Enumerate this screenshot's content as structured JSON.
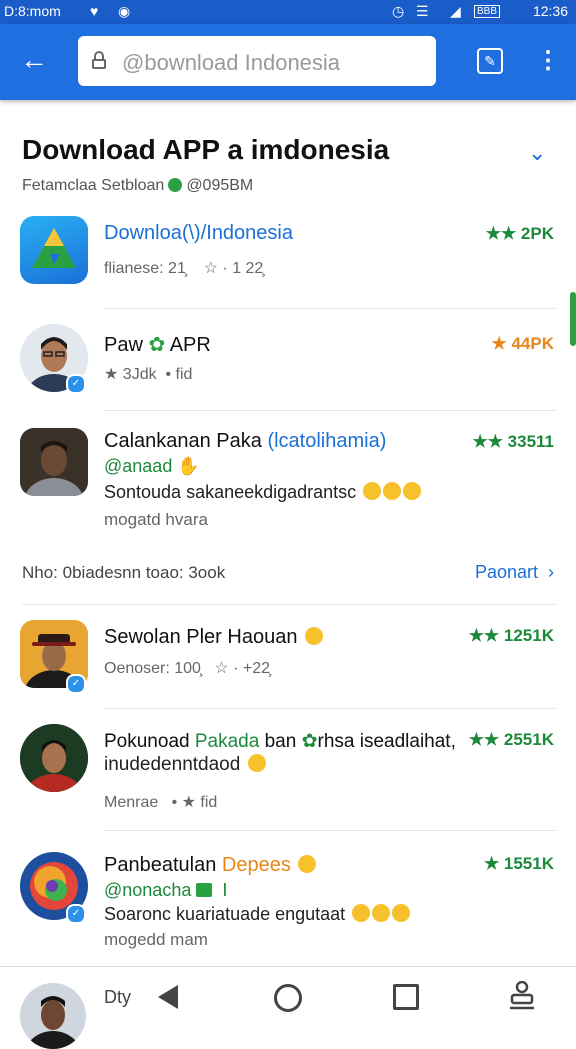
{
  "status_bar": {
    "left_time": "D:8:mom",
    "right_time": "12:36",
    "icons": [
      "heart-icon",
      "notification-icon",
      "alarm-icon",
      "wifi-icon",
      "signal-icon",
      "battery-icon"
    ],
    "battery_text": "BBB"
  },
  "app_bar": {
    "url_text": "@bownload   Indonesia"
  },
  "page": {
    "title": "Download APP a imdonesia",
    "subtitle_left": "Fetamclaa Setbloan",
    "subtitle_right": "@095BM"
  },
  "items_top": [
    {
      "name": "Downloa(\\)/Indonesia",
      "meta_left": "flianese: 21̧",
      "meta_right": "☆ · 1 22̧",
      "rating": "★★ 2PK"
    },
    {
      "name": "Paw",
      "name_suffix": "APR",
      "meta_left": "★ 3Jdk",
      "meta_right": "• fid",
      "rating": "★ 44PK"
    },
    {
      "name": "Calankanan Paka",
      "name_paren": "(lcatolihamia)",
      "handle": "@anaad",
      "desc": "Sontouda sakaneekdigadrantsc",
      "desc2": "mogatd hvara",
      "rating": "★★ 33511"
    }
  ],
  "section": {
    "label": "Nho: 0biadesnn toao: 3ook",
    "link": "Paonart"
  },
  "items_bottom": [
    {
      "name": "Sewolan Pler Haouan",
      "meta_left": "Oenoser: 100̧",
      "meta_right": "☆ · +22̧",
      "rating": "★★ 1251K"
    },
    {
      "name": "Pokunoad",
      "name_green": "Pakada",
      "name_tail": "ban",
      "name_tail2": "rhsa iseadlaihat,",
      "line2": "inudedenntdaod",
      "meta_left": "Menrae",
      "meta_right": "• ★ fid",
      "rating": "★★ 2551K"
    },
    {
      "name": "Panbeatulan",
      "name_orange": "Depees",
      "handle": "@nonacha",
      "desc": "Soaronc kuariatuade engutaat",
      "desc2": "mogedd mam",
      "rating": "★ 1551K"
    }
  ],
  "bottom_bar": {
    "label": "Dty"
  },
  "colors": {
    "app_bar": "#1f6fe0",
    "status_bar": "#1a5cc8",
    "accent_green": "#1c8a3a",
    "link_blue": "#1a6fd8",
    "rating_orange": "#e8861a"
  }
}
